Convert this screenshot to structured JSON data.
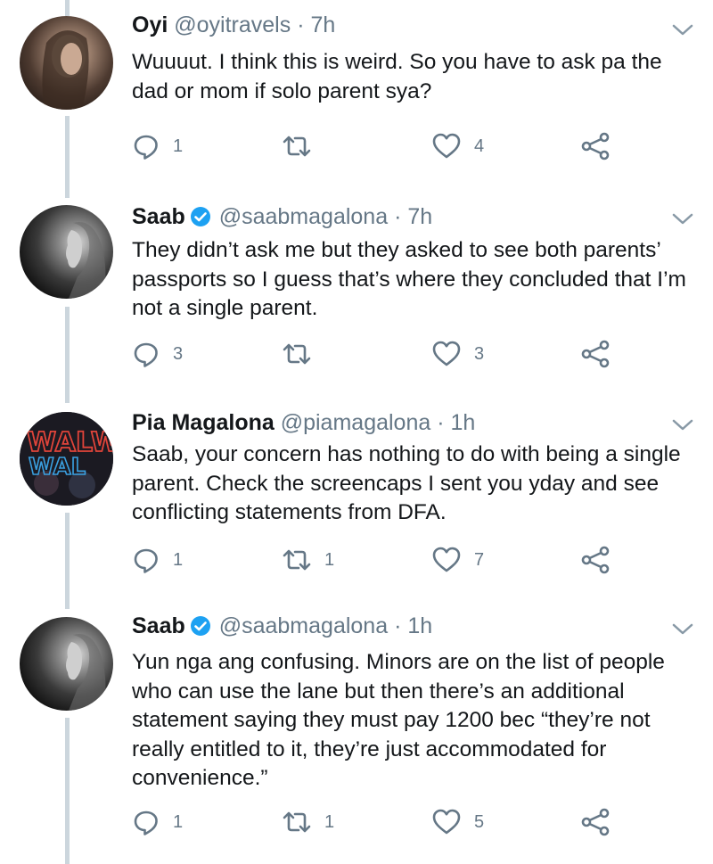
{
  "tweets": [
    {
      "name": "Oyi",
      "handle": "@oyitravels",
      "dot": "·",
      "time": "7h",
      "verified": false,
      "text": [
        "Wuuuut. I think this is weird. So you have to ask pa the",
        "dad or mom if solo parent sya?"
      ],
      "replies": "1",
      "retweets": "",
      "likes": "4"
    },
    {
      "name": "Saab",
      "handle": "@saabmagalona",
      "dot": "·",
      "time": "7h",
      "verified": true,
      "text": [
        "They didn’t ask me but they asked to see both parents’",
        "passports so I guess that’s where they concluded that I’m",
        "not a single parent."
      ],
      "replies": "3",
      "retweets": "",
      "likes": "3"
    },
    {
      "name": "Pia Magalona",
      "handle": "@piamagalona",
      "dot": "·",
      "time": "1h",
      "verified": false,
      "avatar_text": "WALWAL",
      "text": [
        "Saab, your concern has nothing to do with being a single",
        "parent. Check the screencaps I sent you yday and see",
        "conflicting statements from DFA."
      ],
      "replies": "1",
      "retweets": "1",
      "likes": "7"
    },
    {
      "name": "Saab",
      "handle": "@saabmagalona",
      "dot": "·",
      "time": "1h",
      "verified": true,
      "text": [
        "Yun nga ang confusing. Minors are on the list of people",
        "who can use the lane but then there’s an additional",
        "statement saying they must pay 1200  bec “they’re not",
        "really entitled to it, they’re just accommodated for",
        "convenience.”"
      ],
      "replies": "1",
      "retweets": "1",
      "likes": "5"
    }
  ],
  "colors": {
    "verified": "#1da1f2",
    "icon": "#657786",
    "thread_line": "#ccd6dd"
  },
  "icons": [
    "reply-icon",
    "retweet-icon",
    "like-icon",
    "share-icon",
    "chevron-down-icon",
    "verified-badge-icon"
  ]
}
